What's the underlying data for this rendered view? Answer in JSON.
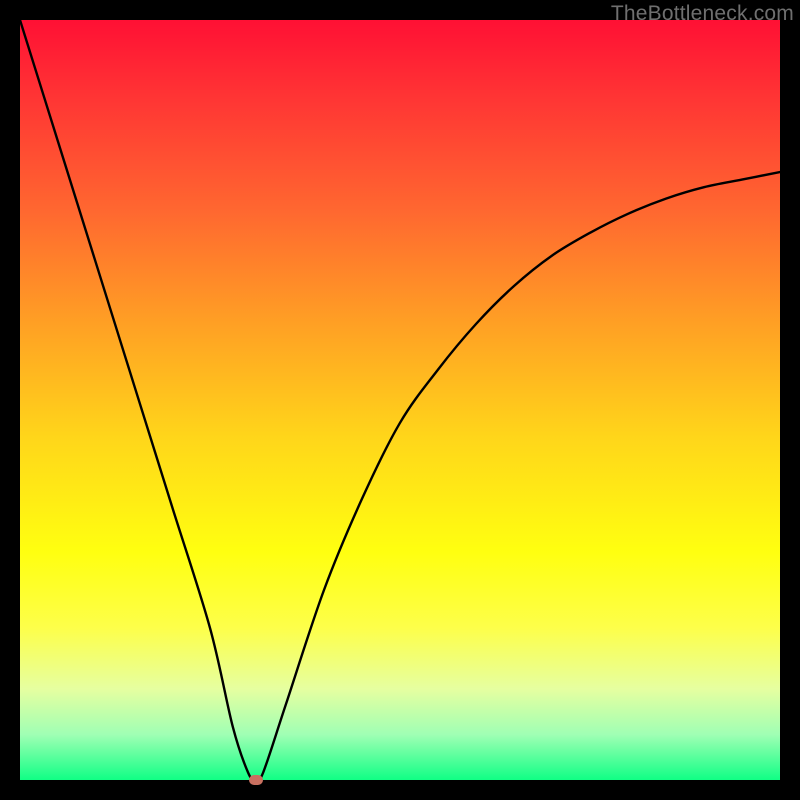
{
  "watermark": "TheBottleneck.com",
  "colors": {
    "marker": "#c97060",
    "curve": "#000000"
  },
  "chart_data": {
    "type": "line",
    "title": "",
    "xlabel": "",
    "ylabel": "",
    "xlim": [
      0,
      100
    ],
    "ylim": [
      0,
      100
    ],
    "grid": false,
    "x": [
      0,
      5,
      10,
      15,
      20,
      25,
      28,
      30,
      31,
      32,
      35,
      40,
      45,
      50,
      55,
      60,
      65,
      70,
      75,
      80,
      85,
      90,
      95,
      100
    ],
    "values": [
      100,
      84,
      68,
      52,
      36,
      20,
      7,
      1,
      0,
      1,
      10,
      25,
      37,
      47,
      54,
      60,
      65,
      69,
      72,
      74.5,
      76.5,
      78,
      79,
      80
    ],
    "annotations": [
      {
        "type": "marker",
        "x": 31,
        "y": 0
      }
    ]
  }
}
